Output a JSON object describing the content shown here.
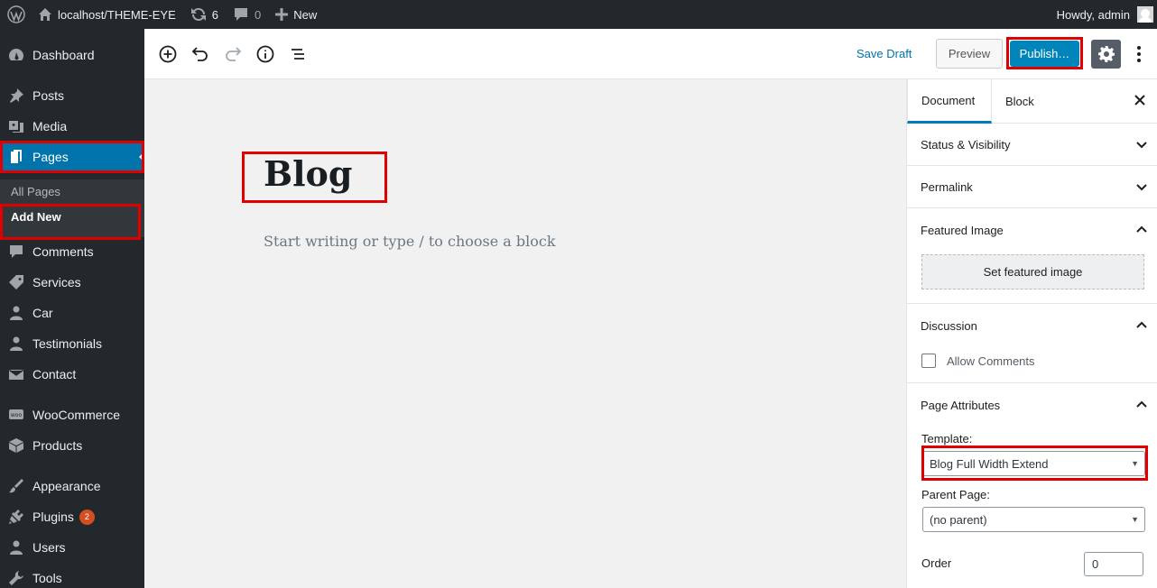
{
  "adminbar": {
    "site": "localhost/THEME-EYE",
    "updates": "6",
    "comments": "0",
    "new": "New",
    "howdy": "Howdy, admin"
  },
  "sidebar": {
    "items": [
      {
        "label": "Dashboard",
        "icon": "dashboard-icon"
      },
      {
        "label": "Posts",
        "icon": "pin-icon"
      },
      {
        "label": "Media",
        "icon": "media-icon"
      },
      {
        "label": "Pages",
        "icon": "pages-icon"
      },
      {
        "label": "Comments",
        "icon": "comment-icon"
      },
      {
        "label": "Services",
        "icon": "tag-icon"
      },
      {
        "label": "Car",
        "icon": "person-icon"
      },
      {
        "label": "Testimonials",
        "icon": "person-icon"
      },
      {
        "label": "Contact",
        "icon": "envelope-icon"
      },
      {
        "label": "WooCommerce",
        "icon": "woo-icon"
      },
      {
        "label": "Products",
        "icon": "box-icon"
      },
      {
        "label": "Appearance",
        "icon": "brush-icon"
      },
      {
        "label": "Plugins",
        "icon": "plugin-icon",
        "badge": "2"
      },
      {
        "label": "Users",
        "icon": "user-icon"
      },
      {
        "label": "Tools",
        "icon": "wrench-icon"
      }
    ],
    "submenu": [
      "All Pages",
      "Add New"
    ]
  },
  "toolbar": {
    "save_draft": "Save Draft",
    "preview": "Preview",
    "publish": "Publish…"
  },
  "editor": {
    "title": "Blog",
    "placeholder": "Start writing or type / to choose a block"
  },
  "panel": {
    "tabs": [
      "Document",
      "Block"
    ],
    "sections": {
      "status": "Status & Visibility",
      "permalink": "Permalink",
      "featured": "Featured Image",
      "discussion": "Discussion",
      "attributes": "Page Attributes"
    },
    "set_featured": "Set featured image",
    "allow_comments": "Allow Comments",
    "template_label": "Template:",
    "template_value": "Blog Full Width Extend",
    "parent_label": "Parent Page:",
    "parent_value": "(no parent)",
    "order_label": "Order",
    "order_value": "0"
  },
  "colors": {
    "admin_dark": "#23282d",
    "accent": "#0073aa",
    "publish": "#0085ba",
    "highlight": "#e00000"
  }
}
